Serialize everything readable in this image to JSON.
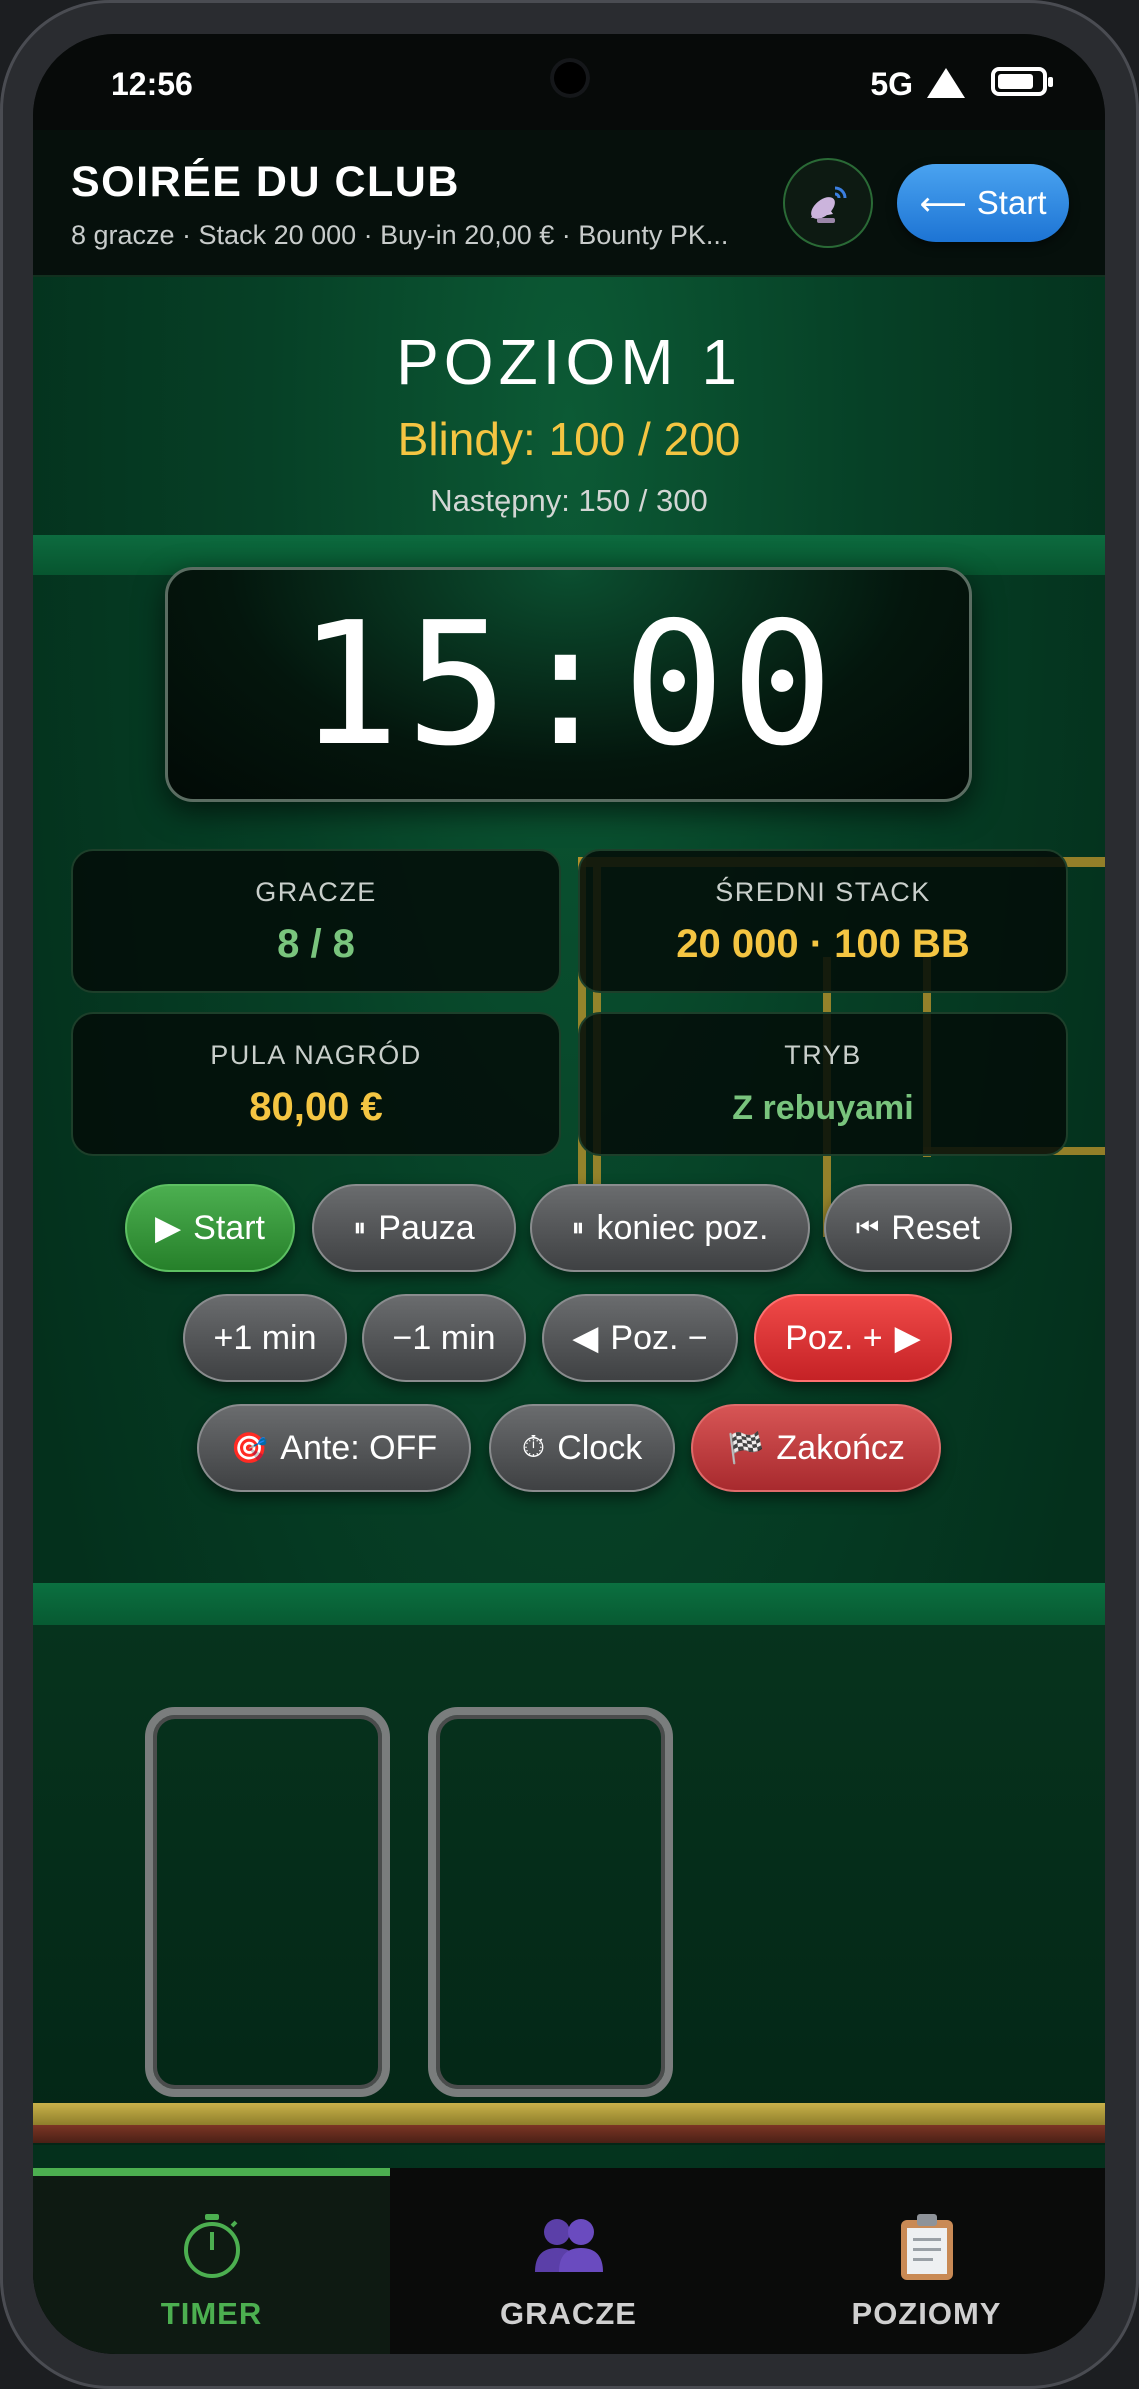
{
  "status": {
    "time": "12:56",
    "network": "5G"
  },
  "header": {
    "title": "SOIRÉE DU CLUB",
    "subtitle": "8 gracze · Stack 20 000 · Buy-in 20,00 € · Bounty PK...",
    "start_label": "Start"
  },
  "level": {
    "title": "POZIOM 1",
    "blinds": "Blindy: 100 / 200",
    "next": "Następny: 150 / 300"
  },
  "clock": {
    "time": "15:00"
  },
  "stats": {
    "players": {
      "label": "GRACZE",
      "value": "8 / 8"
    },
    "avg_stack": {
      "label": "ŚREDNI STACK",
      "value": "20 000 · 100 BB"
    },
    "prize_pool": {
      "label": "PULA NAGRÓD",
      "value": "80,00 €"
    },
    "mode": {
      "label": "TRYB",
      "value": "Z rebuyami"
    }
  },
  "controls": {
    "start": "Start",
    "pause": "Pauza",
    "end_level": "koniec poz.",
    "reset": "Reset",
    "plus_min": "+1 min",
    "minus_min": "−1 min",
    "level_down": "Poz. −",
    "level_up": "Poz. +",
    "ante": "Ante: OFF",
    "clock": "Clock",
    "finish": "Zakończ"
  },
  "nav": {
    "timer": "TIMER",
    "players": "GRACZE",
    "levels": "POZIOMY",
    "active": "timer"
  },
  "colors": {
    "accent_green": "#4caf50",
    "blinds_yellow": "#f4c542",
    "value_green": "#79c47d",
    "danger_red": "#e53935",
    "primary_blue": "#2f8ae6"
  }
}
